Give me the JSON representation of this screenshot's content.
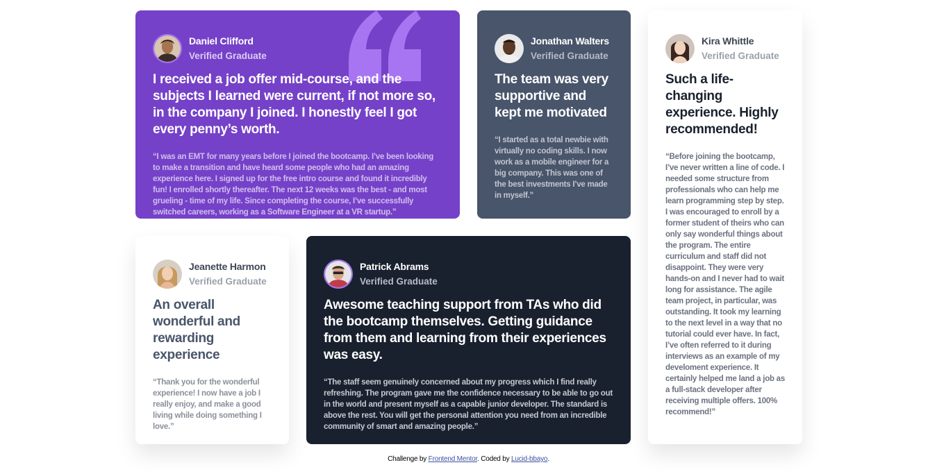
{
  "cards": [
    {
      "name": "Daniel Clifford",
      "role": "Verified Graduate",
      "headline": "I received a job offer mid-course, and the subjects I learned were current, if not more so, in the company I joined. I honestly feel I got every penny’s worth.",
      "body": "“I was an EMT for many years before I joined the bootcamp. I’ve been looking to make a transition and have heard some people who had an amazing experience here. I signed up for the free intro course and found it incredibly fun! I enrolled shortly thereafter. The next 12 weeks was the best - and most grueling - time of my life. Since completing the course, I’ve successfully switched careers, working as a Software Engineer at a VR startup.”",
      "bg": "#7541c8"
    },
    {
      "name": "Jonathan Walters",
      "role": "Verified Graduate",
      "headline": "The team was very supportive and kept me motivated",
      "body": "“I started as a total newbie with virtually no coding skills. I now work as a mobile engineer for a big company. This was one of the best investments I’ve made in myself.”",
      "bg": "#48556a"
    },
    {
      "name": "Kira Whittle",
      "role": "Verified Graduate",
      "headline": "Such a life-changing experience. Highly recommended!",
      "body": "“Before joining the bootcamp, I’ve never written a line of code. I needed some structure from professionals who can help me learn programming step by step. I was encouraged to enroll by a former student of theirs who can only say wonderful things about the program. The entire curriculum and staff did not disappoint. They were very hands-on and I never had to wait long for assistance. The agile team project, in particular, was outstanding. It took my learning to the next level in a way that no tutorial could ever have. In fact, I’ve often referred to it during interviews as an example of my develoment experience. It certainly helped me land a job as a full-stack developer after receiving multiple offers. 100% recommend!”",
      "bg": "#ffffff"
    },
    {
      "name": "Jeanette Harmon",
      "role": "Verified Graduate",
      "headline": "An overall wonderful and rewarding experience",
      "body": "“Thank you for the wonderful experience! I now have a job I really enjoy, and make a good living while doing something I love.”",
      "bg": "#ffffff"
    },
    {
      "name": "Patrick Abrams",
      "role": "Verified Graduate",
      "headline": "Awesome teaching support from TAs who did the bootcamp themselves. Getting guidance from them and learning from their experiences was easy.",
      "body": "“The staff seem genuinely concerned about my progress which I find really refreshing. The program gave me the confidence necessary to be able to go out in the world and present myself as a capable junior developer. The standard is above the rest. You will get the personal attention you need from an incredible community of smart and amazing people.”",
      "bg": "#19212e"
    }
  ],
  "footer": {
    "prefix": "Challenge by",
    "link1": "Frontend Mentor",
    "middle": ". Coded by",
    "link2": "Lucid-bbayo",
    "suffix": "."
  },
  "icons": {
    "quote": "quotation-icon",
    "accent": "#a775f1"
  }
}
